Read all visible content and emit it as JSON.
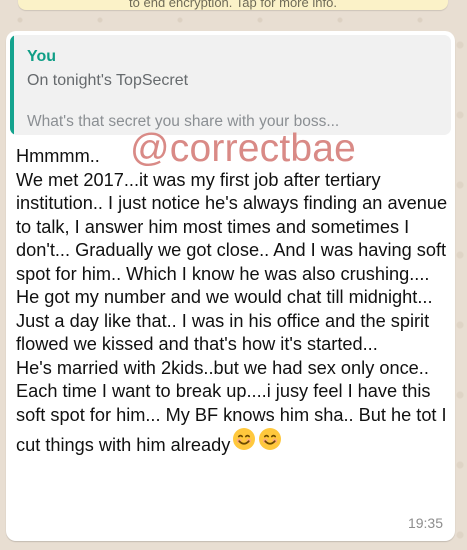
{
  "system_banner": {
    "text": "to end encryption. Tap for more info."
  },
  "quoted_message": {
    "author": "You",
    "line1": "On tonight's TopSecret",
    "preview": "What's that secret you share with your boss..."
  },
  "message": {
    "body_before_emoji": "Hmmmm..\nWe met 2017...it was my first job after tertiary institution.. I just notice he's always finding an avenue to talk, I answer him most times and sometimes I don't... Gradually we got close.. And I was having soft spot for him.. Which I know he was also crushing.... He got my number and we would chat till midnight... Just a day like that.. I was in his office and the spirit flowed we kissed and that's how it's started...\nHe's married with 2kids..but we had sex only once.. Each time I want to break up....i jusy feel I have this soft spot for him... My BF knows him sha.. But he tot I cut things with him already",
    "emojis": [
      "smiling-face-with-smiling-eyes",
      "smiling-face-with-smiling-eyes"
    ],
    "time": "19:35"
  },
  "overlay": {
    "watermark": "@correctbae"
  }
}
